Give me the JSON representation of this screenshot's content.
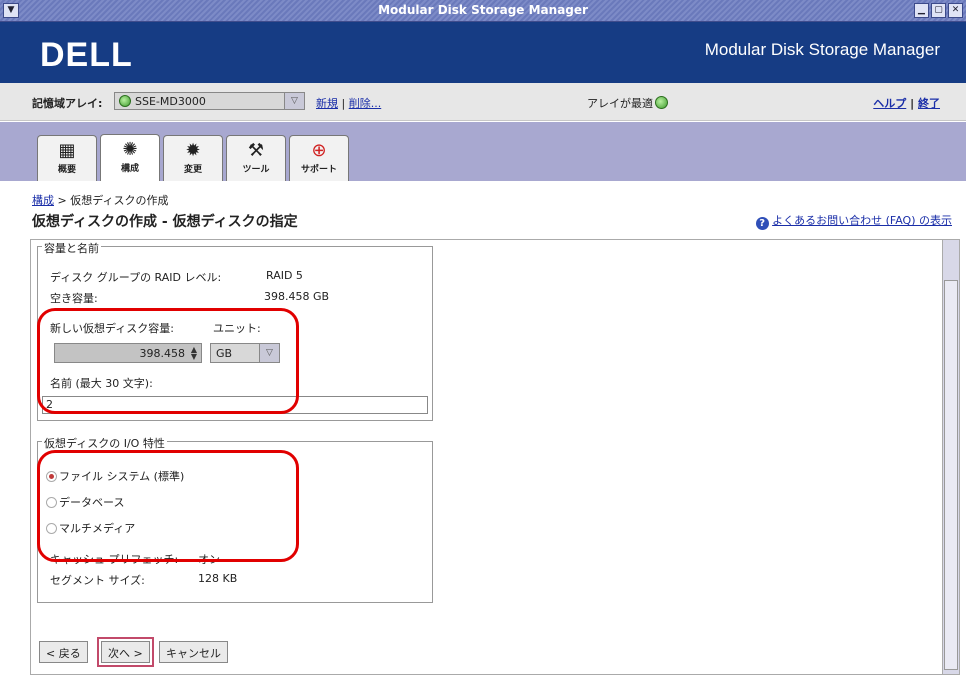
{
  "window": {
    "title": "Modular Disk Storage Manager"
  },
  "banner": {
    "logo": "DELL",
    "title": "Modular Disk Storage Manager"
  },
  "arraybar": {
    "label": "記憶域アレイ:",
    "array_name": "SSE-MD3000",
    "new_link": "新規",
    "separator": "|",
    "remove_link": "削除...",
    "status_text": "アレイが最適",
    "help_link": "ヘルプ",
    "exit_link": "終了"
  },
  "tabs": [
    {
      "label": "概要",
      "icon": "summary-icon"
    },
    {
      "label": "構成",
      "icon": "configure-icon"
    },
    {
      "label": "変更",
      "icon": "modify-icon"
    },
    {
      "label": "ツール",
      "icon": "tools-icon"
    },
    {
      "label": "サポート",
      "icon": "support-icon"
    }
  ],
  "breadcrumb": {
    "link": "構成",
    "sep": ">",
    "current": "仮想ディスクの作成"
  },
  "page_title": "仮想ディスクの作成 - 仮想ディスクの指定",
  "faq_link": "よくあるお問い合わせ (FAQ) の表示",
  "capacity_group": {
    "legend": "容量と名前",
    "raid_label": "ディスク グループの RAID レベル:",
    "raid_value": "RAID 5",
    "free_label": "空き容量:",
    "free_value": "398.458 GB",
    "new_capacity_label": "新しい仮想ディスク容量:",
    "unit_label": "ユニット:",
    "capacity_value": "398.458",
    "unit_value": "GB",
    "name_label": "名前 (最大 30 文字):",
    "name_value": "2"
  },
  "io_group": {
    "legend": "仮想ディスクの I/O 特性",
    "options": [
      "ファイル システム (標準)",
      "データベース",
      "マルチメディア"
    ],
    "selected": "ファイル システム (標準)",
    "cache_label": "キャッシュ プリフェッチ:",
    "cache_value": "オン",
    "segment_label": "セグメント サイズ:",
    "segment_value": "128 KB"
  },
  "buttons": {
    "back": "< 戻る",
    "next": "次へ >",
    "cancel": "キャンセル"
  },
  "colors": {
    "banner": "#163c84",
    "tabbar": "#a8a8d0",
    "highlight": "#e10000",
    "link": "#1a2ea8"
  }
}
